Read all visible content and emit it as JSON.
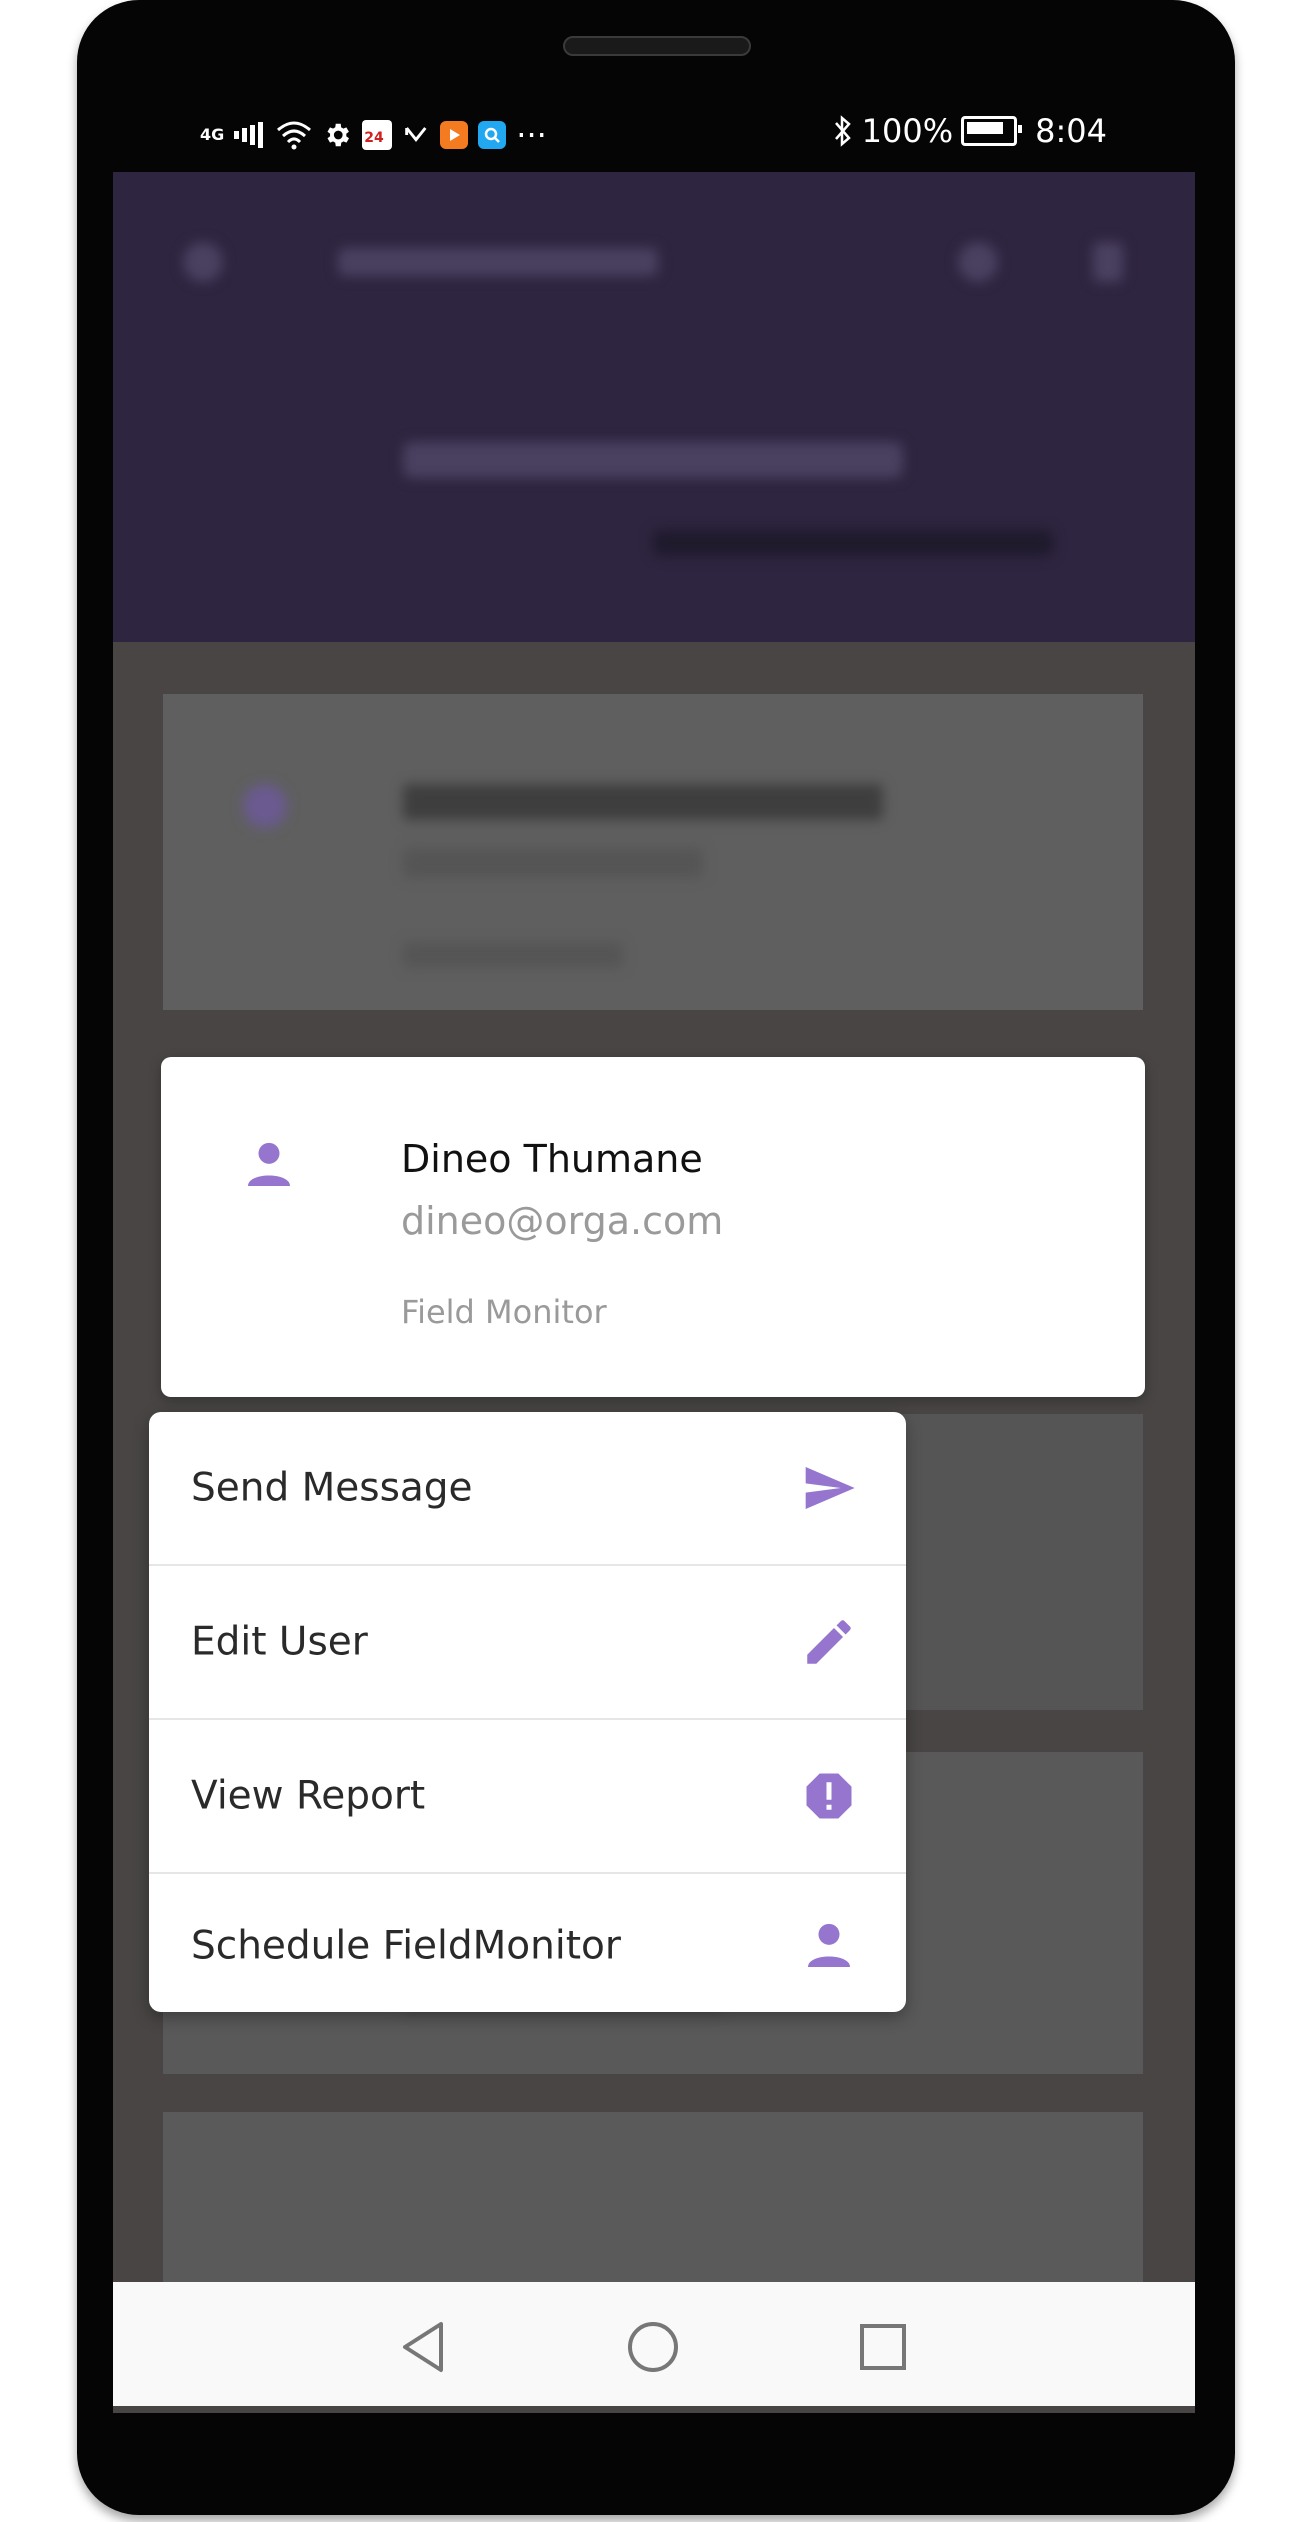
{
  "status_bar": {
    "network": "4G",
    "calendar_day": "24",
    "more": "···",
    "battery": "100%",
    "time": "8:04"
  },
  "user_card": {
    "name": "Dineo Thumane",
    "email": "dineo@orga.com",
    "role": "Field Monitor"
  },
  "menu": {
    "items": [
      {
        "label": "Send Message",
        "icon": "send-icon"
      },
      {
        "label": "Edit User",
        "icon": "pencil-icon"
      },
      {
        "label": "View Report",
        "icon": "alert-octagon-icon"
      },
      {
        "label": "Schedule FieldMonitor",
        "icon": "person-icon"
      }
    ]
  },
  "colors": {
    "accent": "#9575cd",
    "header_dim": "#2e2540",
    "overlay": "#484544"
  }
}
